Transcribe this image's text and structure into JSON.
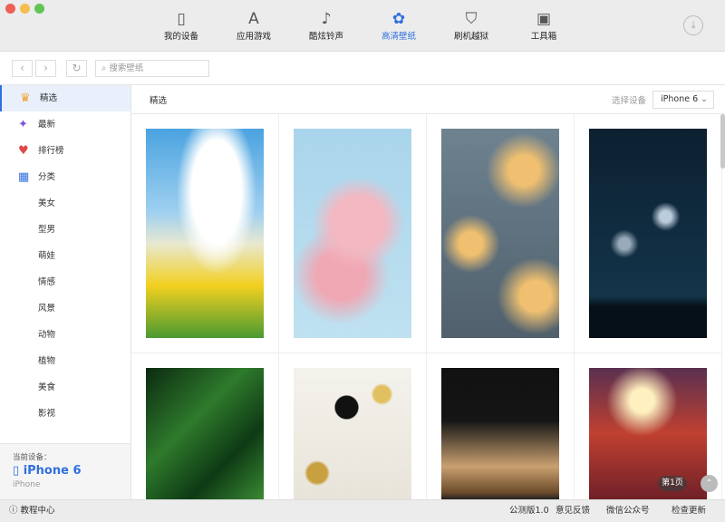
{
  "window": {
    "lights": [
      "#ee5f57",
      "#f5bd4f",
      "#61c554"
    ]
  },
  "tabs": [
    {
      "label": "我的设备",
      "icon": "phone-icon"
    },
    {
      "label": "应用游戏",
      "icon": "app-store-icon"
    },
    {
      "label": "酷炫铃声",
      "icon": "music-note-icon"
    },
    {
      "label": "高清壁纸",
      "icon": "flower-icon",
      "active": true
    },
    {
      "label": "刷机越狱",
      "icon": "shield-icon"
    },
    {
      "label": "工具箱",
      "icon": "toolbox-icon"
    }
  ],
  "accent": "#2f6fde",
  "search": {
    "placeholder": "搜索壁纸"
  },
  "sidebar": {
    "items": [
      {
        "label": "精选",
        "icon": "crown-icon"
      },
      {
        "label": "最新",
        "icon": "magic-wand-icon"
      },
      {
        "label": "排行榜",
        "icon": "medal-icon"
      },
      {
        "label": "分类",
        "icon": "grid-icon"
      },
      {
        "label": "美女"
      },
      {
        "label": "型男"
      },
      {
        "label": "萌娃"
      },
      {
        "label": "情感"
      },
      {
        "label": "风景"
      },
      {
        "label": "动物"
      },
      {
        "label": "植物"
      },
      {
        "label": "美食"
      },
      {
        "label": "影视"
      }
    ],
    "device_label": "当前设备：",
    "device_name": "iPhone 6",
    "device_type": "iPhone"
  },
  "main": {
    "title": "精选",
    "select_label": "选择设备",
    "select_value": "iPhone 6",
    "page_badge": "第1页",
    "wallpapers": [
      "girl-sunflowers",
      "pink-blossoms",
      "light-bulbs",
      "fireworks-night",
      "green-leaves",
      "gold-desk",
      "louvre-night",
      "captain-marvel"
    ]
  },
  "footer": {
    "help": "教程中心",
    "version": "公测版1.0",
    "feedback": "意见反馈",
    "wechat": "微信公众号",
    "update": "检查更新"
  }
}
